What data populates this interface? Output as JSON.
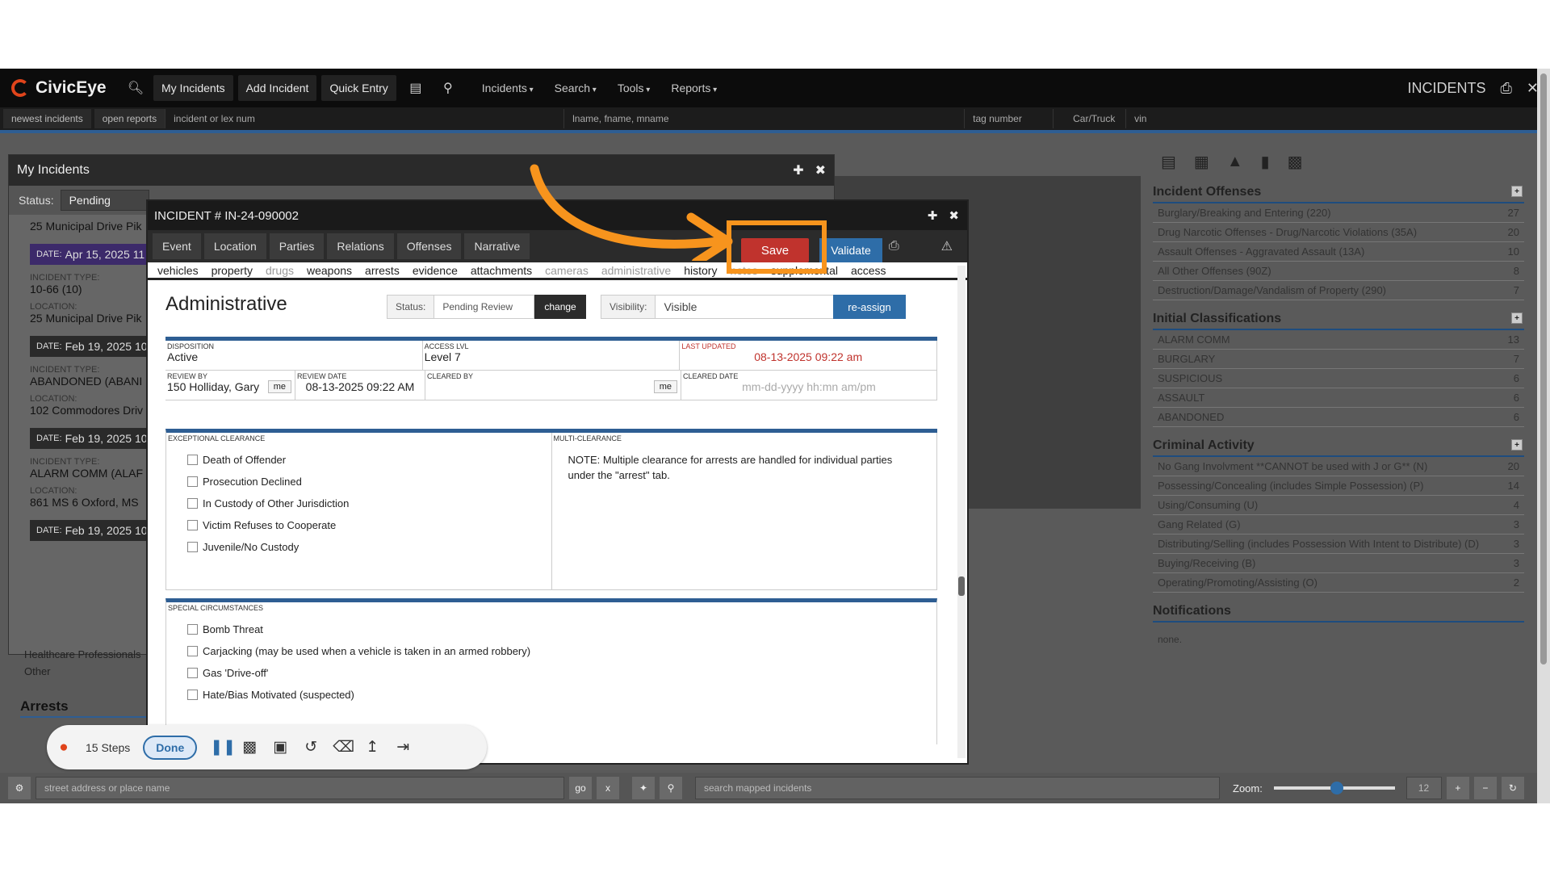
{
  "app": {
    "name": "CivicEye"
  },
  "topbar": {
    "buttons": [
      "My Incidents",
      "Add Incident",
      "Quick Entry"
    ],
    "menus": [
      "Incidents",
      "Search",
      "Tools",
      "Reports"
    ],
    "right_label": "INCIDENTS"
  },
  "searchbar": {
    "chips": [
      "newest incidents",
      "open reports"
    ],
    "fields": [
      "incident or lex num",
      "lname, fname, mname",
      "tag number",
      "Car/Truck",
      "vin"
    ]
  },
  "right_panel": {
    "sections": [
      {
        "title": "Incident Offenses",
        "rows": [
          {
            "label": "Burglary/Breaking and Entering (220)",
            "count": "27"
          },
          {
            "label": "Drug Narcotic Offenses - Drug/Narcotic Violations (35A)",
            "count": "20"
          },
          {
            "label": "Assault Offenses - Aggravated Assault (13A)",
            "count": "10"
          },
          {
            "label": "All Other Offenses (90Z)",
            "count": "8"
          },
          {
            "label": "Destruction/Damage/Vandalism of Property (290)",
            "count": "7"
          }
        ]
      },
      {
        "title": "Initial Classifications",
        "rows": [
          {
            "label": "ALARM COMM",
            "count": "13"
          },
          {
            "label": "BURGLARY",
            "count": "7"
          },
          {
            "label": "SUSPICIOUS",
            "count": "6"
          },
          {
            "label": "ASSAULT",
            "count": "6"
          },
          {
            "label": "ABANDONED",
            "count": "6"
          }
        ]
      },
      {
        "title": "Criminal Activity",
        "rows": [
          {
            "label": "No Gang Involvment **CANNOT be used with J or G** (N)",
            "count": "20"
          },
          {
            "label": "Possessing/Concealing (includes Simple Possession) (P)",
            "count": "14"
          },
          {
            "label": "Using/Consuming (U)",
            "count": "4"
          },
          {
            "label": "Gang Related (G)",
            "count": "3"
          },
          {
            "label": "Distributing/Selling (includes Possession With Intent to Distribute) (D)",
            "count": "3"
          },
          {
            "label": "Buying/Receiving (B)",
            "count": "3"
          },
          {
            "label": "Operating/Promoting/Assisting (O)",
            "count": "2"
          }
        ]
      }
    ],
    "notifications_title": "Notifications",
    "notifications_text": "none."
  },
  "my_incidents": {
    "title": "My Incidents",
    "status_label": "Status:",
    "status_value": "Pending",
    "items": [
      {
        "location": "25 Municipal Drive Pik"
      },
      {
        "date": "Apr 15, 2025 11",
        "type": "10-66 (10)",
        "location": "25 Municipal Drive Pik"
      },
      {
        "date": "Feb 19, 2025 10",
        "type": "ABANDONED (ABANI",
        "location": "102 Commodores Driv"
      },
      {
        "date": "Feb 19, 2025 10",
        "type": "ALARM COMM (ALAF",
        "location": "861 MS 6 Oxford, MS"
      },
      {
        "date": "Feb 19, 2025 10"
      }
    ],
    "labels": {
      "date": "DATE:",
      "type": "INCIDENT TYPE:",
      "location": "LOCATION:"
    },
    "below": [
      "Healthcare Professionals",
      "Other"
    ],
    "arrests_title": "Arrests"
  },
  "modal": {
    "title": "INCIDENT # IN-24-090002",
    "tabs": [
      "Event",
      "Location",
      "Parties",
      "Relations",
      "Offenses",
      "Narrative"
    ],
    "save_label": "Save",
    "validate_label": "Validate",
    "subtabs": [
      "vehicles",
      "property",
      "drugs",
      "weapons",
      "arrests",
      "evidence",
      "attachments",
      "cameras",
      "administrative",
      "history",
      "notes",
      "supplemental",
      "access"
    ],
    "section_title": "Administrative",
    "status_label": "Status:",
    "status_value": "Pending Review",
    "change_label": "change",
    "visibility_label": "Visibility:",
    "visibility_value": "Visible",
    "reassign_label": "re-assign",
    "disposition_label": "DISPOSITION",
    "disposition": "Active",
    "access_label": "ACCESS LVL",
    "access": "Level 7",
    "updated_label": "LAST UPDATED",
    "updated": "08-13-2025 09:22 am",
    "review_by_label": "REVIEW BY",
    "review_by": "150 Holliday, Gary",
    "me_label": "me",
    "review_date_label": "REVIEW DATE",
    "review_date": "08-13-2025 09:22 AM",
    "cleared_by_label": "CLEARED BY",
    "cleared_date_label": "CLEARED DATE",
    "cleared_date_placeholder": "mm-dd-yyyy hh:mn am/pm",
    "exceptional_label": "EXCEPTIONAL CLEARANCE",
    "exceptional": [
      "Death of Offender",
      "Prosecution Declined",
      "In Custody of Other Jurisdiction",
      "Victim Refuses to Cooperate",
      "Juvenile/No Custody"
    ],
    "multi_label": "MULTI-CLEARANCE",
    "multi_note": "NOTE: Multiple clearance for arrests are handled for individual parties under the \"arrest\" tab.",
    "special_label": "SPECIAL CIRCUMSTANCES",
    "special": [
      "Bomb Threat",
      "Carjacking (may be used when a vehicle is taken in an armed robbery)",
      "Gas 'Drive-off'",
      "Hate/Bias Motivated (suspected)"
    ]
  },
  "step_toolbar": {
    "steps": "15 Steps",
    "done": "Done"
  },
  "bottombar": {
    "address_placeholder": "street address or place name",
    "go": "go",
    "x": "x",
    "search_placeholder": "search mapped incidents",
    "zoom_label": "Zoom:",
    "zoom_value": "12"
  },
  "colors": {
    "accent": "#2e6da8",
    "save": "#c0332d",
    "highlight": "#f7941d"
  }
}
